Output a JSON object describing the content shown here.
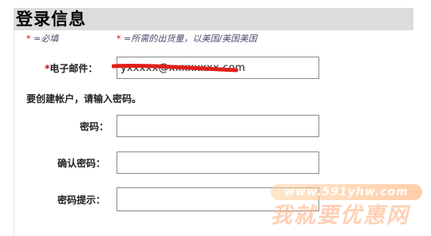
{
  "header": {
    "title": "登录信息"
  },
  "notes": [
    {
      "star": "*",
      "text": " =必填"
    },
    {
      "star": "*",
      "text": " =所需的出货量，以美国/美国美国"
    }
  ],
  "form": {
    "email": {
      "required_mark": "*",
      "label": "电子邮件：",
      "value": "yxxxxx@xxxxxxxx.com"
    },
    "instruction": "要创建帐户，请输入密码。",
    "password": {
      "label": "密码：",
      "value": ""
    },
    "confirm_password": {
      "label": "确认密码：",
      "value": ""
    },
    "password_hint": {
      "label": "密码提示：",
      "value": ""
    }
  },
  "watermark": {
    "url": "www.591yhw.com",
    "text": "我就要优惠网"
  },
  "colors": {
    "header_bg": "#dcdcdc",
    "required_star": "#c00000",
    "redaction": "#e0201c",
    "watermark": "#ffaa78"
  }
}
